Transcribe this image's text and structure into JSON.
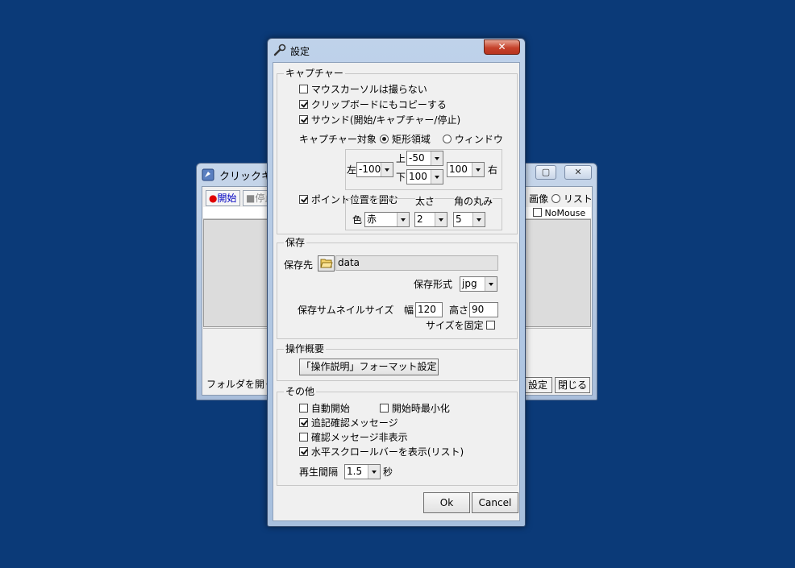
{
  "background_window": {
    "title": "クリックキ",
    "toolbar": {
      "start": "開始",
      "stop": "停止"
    },
    "radio_image": "画像",
    "radio_list": "リスト",
    "nomouse": "NoMouse",
    "open_folder": "フォルダを開く",
    "settings": "設定",
    "close": "閉じる"
  },
  "dialog": {
    "title": "設定",
    "close_glyph": "✕",
    "capture": {
      "legend": "キャプチャー",
      "no_cursor": {
        "label": "マウスカーソルは撮らない",
        "checked": false
      },
      "copy_clipboard": {
        "label": "クリップボードにもコピーする",
        "checked": true
      },
      "sound": {
        "label": "サウンド(開始/キャプチャー/停止)",
        "checked": true
      },
      "target_label": "キャプチャー対象",
      "target_rect": "矩形領域",
      "target_window": "ウィンドウ",
      "left_label": "左",
      "left_value": "-100",
      "top_label": "上",
      "top_value": "-50",
      "bottom_label": "下",
      "bottom_value": "100",
      "right_label": "右",
      "right_value": "100",
      "surround": {
        "label": "ポイント位置を囲む",
        "checked": true
      },
      "thickness_label": "太さ",
      "corner_label": "角の丸み",
      "color_label": "色",
      "color_value": "赤",
      "thickness_value": "2",
      "corner_value": "5"
    },
    "save": {
      "legend": "保存",
      "dest_label": "保存先",
      "dest_value": "data",
      "format_label": "保存形式",
      "format_value": "jpg",
      "thumb_label": "保存サムネイルサイズ",
      "width_label": "幅",
      "width_value": "120",
      "height_label": "高さ",
      "height_value": "90",
      "fix_size": {
        "label": "サイズを固定",
        "checked": false
      }
    },
    "operation": {
      "legend": "操作概要",
      "format_button": "「操作説明」フォーマット設定"
    },
    "other": {
      "legend": "その他",
      "auto_start": {
        "label": "自動開始",
        "checked": false
      },
      "minimize_on_start": {
        "label": "開始時最小化",
        "checked": false
      },
      "append_confirm": {
        "label": "追記確認メッセージ",
        "checked": true
      },
      "hide_confirm": {
        "label": "確認メッセージ非表示",
        "checked": false
      },
      "hscroll": {
        "label": "水平スクロールバーを表示(リスト)",
        "checked": true
      },
      "interval_label": "再生間隔",
      "interval_value": "1.5",
      "interval_unit": "秒"
    },
    "ok": "Ok",
    "cancel": "Cancel"
  }
}
